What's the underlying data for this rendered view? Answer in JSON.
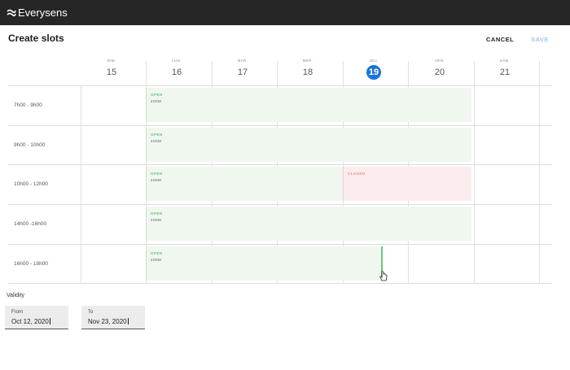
{
  "app": {
    "brand": "Everysens"
  },
  "page": {
    "title": "Create slots"
  },
  "toolbar": {
    "cancel_label": "CANCEL",
    "save_label": "SAVE"
  },
  "calendar": {
    "days": [
      {
        "dow": "DIM.",
        "num": "15",
        "today": false
      },
      {
        "dow": "LUN.",
        "num": "16",
        "today": false
      },
      {
        "dow": "MAR.",
        "num": "17",
        "today": false
      },
      {
        "dow": "MER.",
        "num": "18",
        "today": false
      },
      {
        "dow": "JEU.",
        "num": "19",
        "today": true
      },
      {
        "dow": "VEN.",
        "num": "20",
        "today": false
      },
      {
        "dow": "SAM.",
        "num": "21",
        "today": false
      }
    ],
    "time_slots": [
      "7h00 - 9h00",
      "9h00 - 10h00",
      "10h00 - 12h00",
      "14h00 -16h00",
      "16h00 - 18h00"
    ],
    "events": [
      {
        "status": "OPEN",
        "sub": "400M"
      },
      {
        "status": "OPEN",
        "sub": "400M"
      },
      {
        "status": "OPEN",
        "sub": "400M"
      },
      {
        "status": "CLOSED",
        "sub": ""
      },
      {
        "status": "OPEN",
        "sub": "400M"
      },
      {
        "status": "OPEN",
        "sub": "400M"
      }
    ]
  },
  "validity": {
    "label": "Validity",
    "from": {
      "label": "From",
      "value": "Oct 12, 2020"
    },
    "to": {
      "label": "To",
      "value": "Nov 23, 2020"
    }
  },
  "colors": {
    "topbar": "#262626",
    "accent": "#1976d2",
    "open_bg": "#eff7ef",
    "open_text": "#6cbf7a",
    "closed_bg": "#fdeced",
    "closed_text": "#e08a92"
  }
}
